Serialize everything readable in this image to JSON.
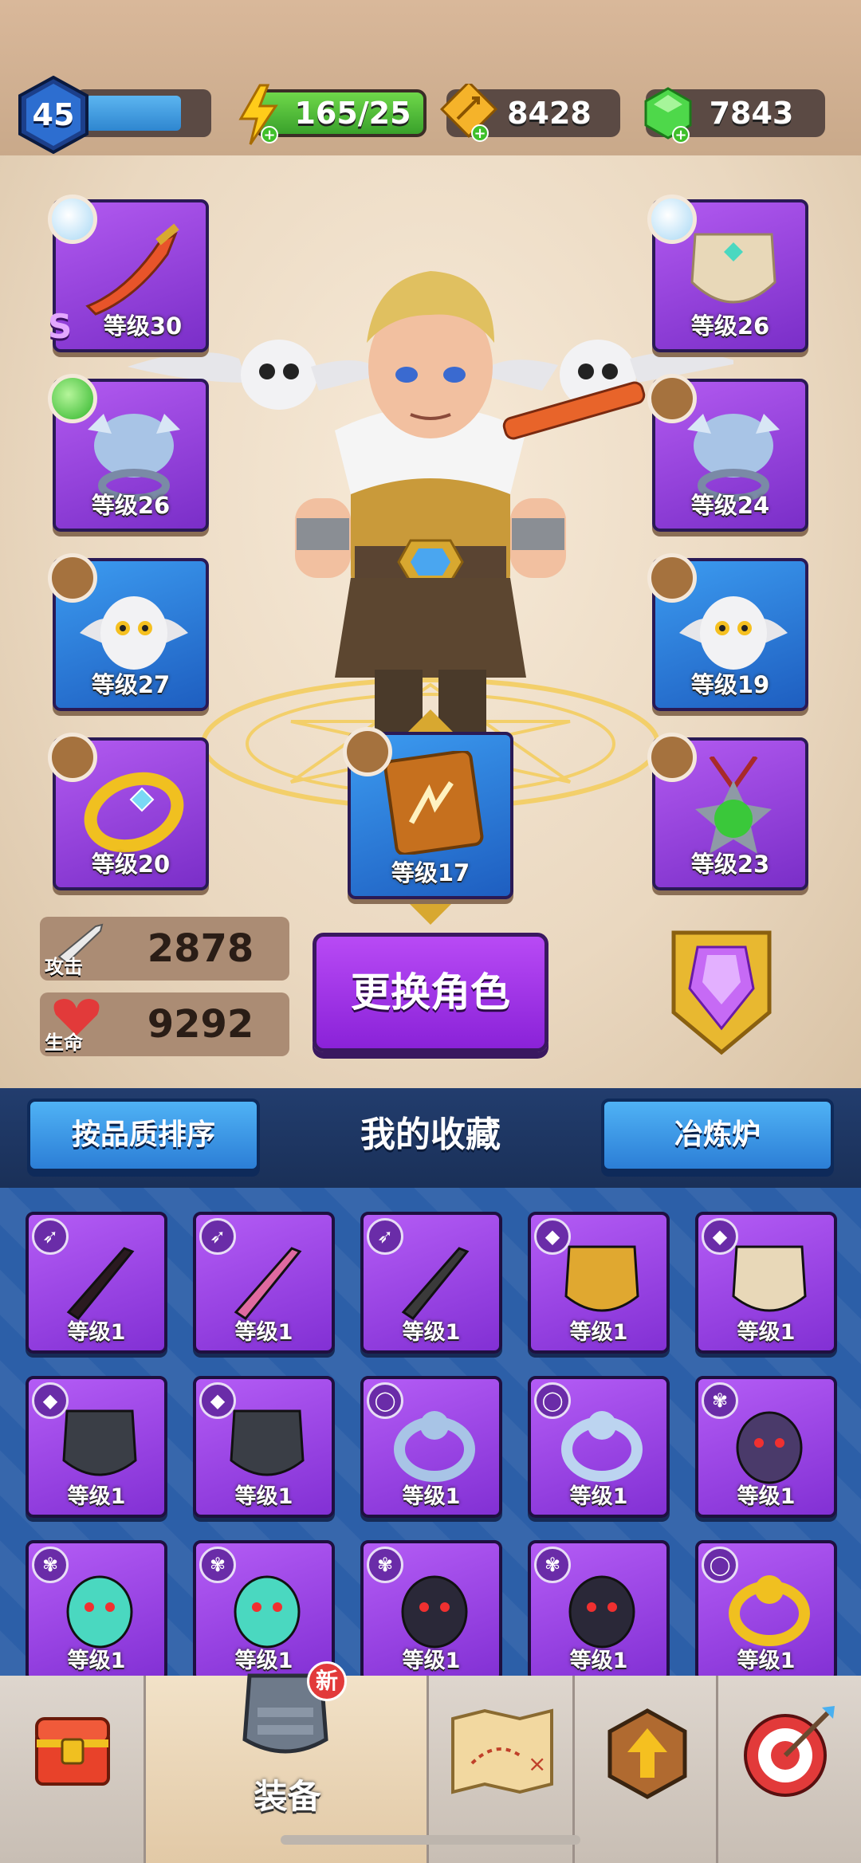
{
  "hud": {
    "player_level": "45",
    "xp_progress": 0.82,
    "energy": "165/25",
    "arrows": "8428",
    "gems": "7843"
  },
  "equipment": {
    "left": [
      {
        "level": "等级30",
        "grade": "S",
        "color": "purple",
        "gem": "ice",
        "icon": "sword-icon"
      },
      {
        "level": "等级26",
        "color": "purple",
        "gem": "green",
        "icon": "bull-ring-icon"
      },
      {
        "level": "等级27",
        "color": "blue",
        "gem": "empty",
        "icon": "owl-icon"
      },
      {
        "level": "等级20",
        "color": "purple",
        "gem": "empty",
        "icon": "gold-ring-icon"
      }
    ],
    "right": [
      {
        "level": "等级26",
        "color": "purple",
        "gem": "ice",
        "icon": "armor-icon"
      },
      {
        "level": "等级24",
        "color": "purple",
        "gem": "empty",
        "icon": "bull-ring-icon"
      },
      {
        "level": "等级19",
        "color": "blue",
        "gem": "empty",
        "icon": "owl-icon"
      },
      {
        "level": "等级23",
        "color": "purple",
        "gem": "empty",
        "icon": "amulet-icon"
      }
    ],
    "book": {
      "level": "等级17",
      "icon": "spellbook-icon"
    }
  },
  "stats": {
    "attack_label": "攻击",
    "attack_value": "2878",
    "hp_label": "生命",
    "hp_value": "9292"
  },
  "change_hero_label": "更换角色",
  "collection": {
    "sort_button": "按品质排序",
    "title": "我的收藏",
    "smelter_button": "冶炼炉",
    "items": [
      {
        "label": "等级1",
        "type": "bow",
        "icon": "scythe-icon"
      },
      {
        "label": "等级1",
        "type": "bow",
        "icon": "pink-blade-icon"
      },
      {
        "label": "等级1",
        "type": "bow",
        "icon": "dark-sword-icon"
      },
      {
        "label": "等级1",
        "type": "armor",
        "icon": "gold-armor-icon"
      },
      {
        "label": "等级1",
        "type": "armor",
        "icon": "white-armor-icon"
      },
      {
        "label": "等级1",
        "type": "armor",
        "icon": "dark-armor-icon"
      },
      {
        "label": "等级1",
        "type": "armor",
        "icon": "dark-armor-icon"
      },
      {
        "label": "等级1",
        "type": "ring",
        "icon": "beast-ring-icon"
      },
      {
        "label": "等级1",
        "type": "ring",
        "icon": "lion-ring-icon"
      },
      {
        "label": "等级1",
        "type": "pet",
        "icon": "reaper-pet-icon"
      },
      {
        "label": "等级1",
        "type": "pet",
        "icon": "ghost-pet-icon"
      },
      {
        "label": "等级1",
        "type": "pet",
        "icon": "ghost-pet-icon"
      },
      {
        "label": "等级1",
        "type": "pet",
        "icon": "bat-pet-icon"
      },
      {
        "label": "等级1",
        "type": "pet",
        "icon": "bat-pet-icon"
      },
      {
        "label": "等级1",
        "type": "ring",
        "icon": "gold-ring-icon"
      }
    ]
  },
  "nav": {
    "active_label": "装备",
    "new_badge": "新",
    "items": [
      "chest-icon",
      "equipment-icon",
      "map-icon",
      "upgrade-icon",
      "target-icon"
    ]
  }
}
